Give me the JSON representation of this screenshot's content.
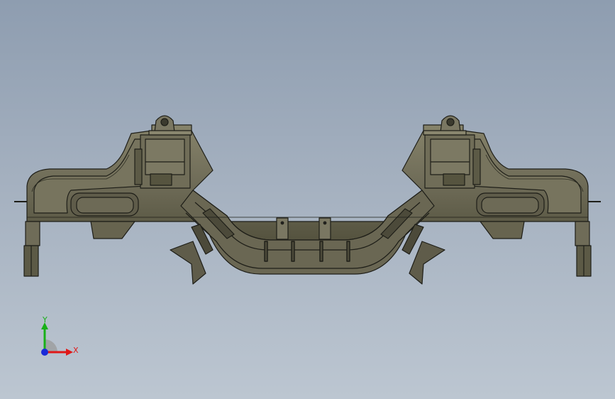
{
  "viewport": {
    "colors": {
      "background_top": "#8e9db0",
      "background_bottom": "#bcc6d1",
      "part_fill": "#6f6c58",
      "part_fill_dark": "#4a4838",
      "part_fill_light": "#8a876f",
      "edge": "#1e1e18"
    }
  },
  "triad": {
    "x_label": "X",
    "y_label": "Y",
    "x_color": "#e01818",
    "y_color": "#18b018",
    "z_color": "#1a2ad8"
  }
}
